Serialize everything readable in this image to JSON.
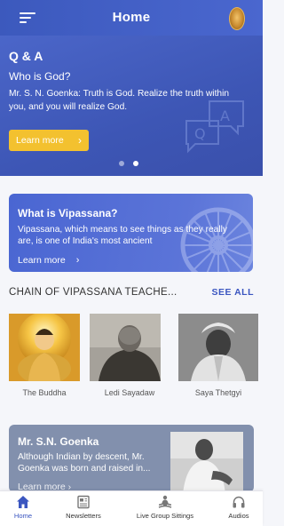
{
  "header": {
    "title": "Home"
  },
  "hero": {
    "heading": "Q & A",
    "question": "Who is God?",
    "answer": "Mr. S. N. Goenka: Truth is God. Realize the truth within you, and you will realize God.",
    "button_label": "Learn more",
    "slides_count": 2,
    "active_slide": 2
  },
  "vipassana": {
    "title": "What is Vipassana?",
    "text": "Vipassana, which means to see things as they really are, is one of India's most ancient",
    "link_label": "Learn more"
  },
  "chain": {
    "title": "CHAIN OF VIPASSANA TEACHE...",
    "see_all": "SEE ALL",
    "teachers": [
      {
        "name": "The Buddha"
      },
      {
        "name": "Ledi Sayadaw"
      },
      {
        "name": "Saya Thetgyi"
      }
    ]
  },
  "goenka": {
    "title": "Mr. S.N. Goenka",
    "text": "Although Indian by descent, Mr. Goenka was born and raised in...",
    "link_label": "Learn more"
  },
  "nav": {
    "items": [
      {
        "label": "Home",
        "icon": "home-icon",
        "active": true
      },
      {
        "label": "Newsletters",
        "icon": "newsletter-icon",
        "active": false
      },
      {
        "label": "Live Group Sittings",
        "icon": "meditation-icon",
        "active": false
      },
      {
        "label": "Audios",
        "icon": "headphones-icon",
        "active": false
      }
    ]
  },
  "colors": {
    "primary": "#3b56c0",
    "accent_yellow": "#f3c12f",
    "goenka_card": "#8290ad"
  }
}
